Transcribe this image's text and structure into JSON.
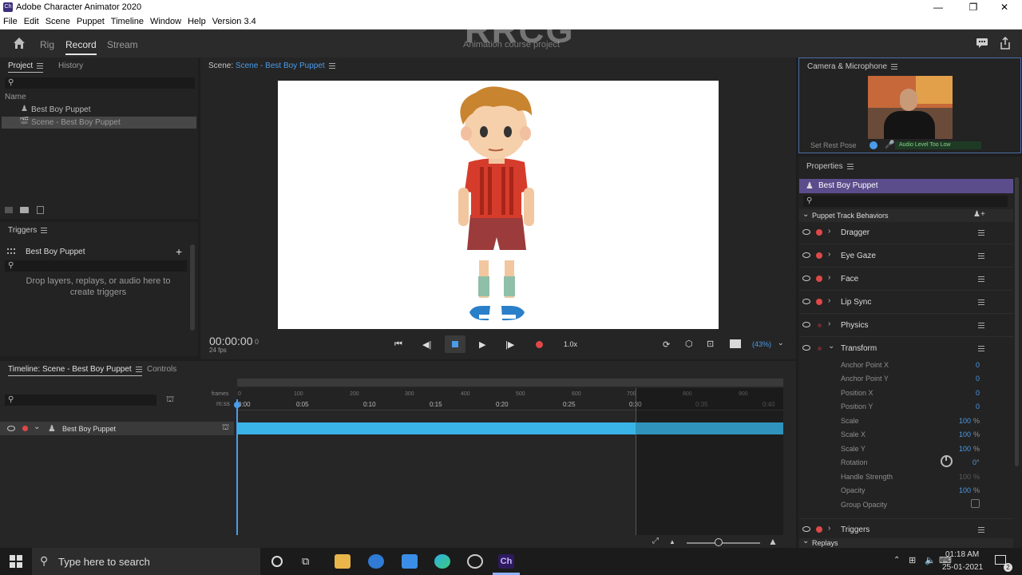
{
  "app": {
    "title": "Adobe Character Animator 2020",
    "icon_text": "Ch"
  },
  "menu": [
    "File",
    "Edit",
    "Scene",
    "Puppet",
    "Timeline",
    "Window",
    "Help",
    "Version 3.4"
  ],
  "modes": {
    "rig": "Rig",
    "record": "Record",
    "stream": "Stream"
  },
  "project_title": "Animation course project",
  "project_panel": {
    "tab_project": "Project",
    "tab_history": "History",
    "name_header": "Name",
    "items": [
      {
        "label": "Best Boy Puppet"
      },
      {
        "label": "Scene - Best Boy Puppet"
      }
    ]
  },
  "triggers_panel": {
    "title": "Triggers",
    "puppet": "Best Boy Puppet",
    "add": "+",
    "drop_hint": "Drop layers, replays, or audio here to create triggers"
  },
  "scene_panel": {
    "prefix": "Scene:",
    "name": "Scene - Best Boy Puppet",
    "timecode": "00:00:00",
    "frame": "0",
    "fps": "24 fps",
    "speed": "1.0x",
    "zoom": "(43%)"
  },
  "timeline": {
    "tab_timeline": "Timeline: Scene - Best Boy Puppet",
    "tab_controls": "Controls",
    "frames_label": "frames",
    "mss_label": "m:ss",
    "frame_ticks": [
      "0",
      "100",
      "200",
      "300",
      "400",
      "500",
      "600",
      "700",
      "800",
      "900"
    ],
    "time_ticks": [
      "0:00",
      "0:05",
      "0:10",
      "0:15",
      "0:20",
      "0:25",
      "0:30",
      "0:35",
      "0:40"
    ],
    "track_name": "Best Boy Puppet"
  },
  "camera_panel": {
    "title": "Camera & Microphone",
    "set_rest_pose": "Set Rest Pose",
    "audio_level": "Audio Level Too Low"
  },
  "properties": {
    "title": "Properties",
    "puppet": "Best Boy Puppet",
    "section": "Puppet Track Behaviors",
    "behaviors": [
      {
        "label": "Dragger"
      },
      {
        "label": "Eye Gaze"
      },
      {
        "label": "Face"
      },
      {
        "label": "Lip Sync"
      },
      {
        "label": "Physics"
      },
      {
        "label": "Transform"
      },
      {
        "label": "Triggers"
      }
    ],
    "transform_params": [
      {
        "label": "Anchor Point X",
        "value": "0",
        "unit": ""
      },
      {
        "label": "Anchor Point Y",
        "value": "0",
        "unit": ""
      },
      {
        "label": "Position X",
        "value": "0",
        "unit": ""
      },
      {
        "label": "Position Y",
        "value": "0",
        "unit": ""
      },
      {
        "label": "Scale",
        "value": "100",
        "unit": "%"
      },
      {
        "label": "Scale X",
        "value": "100",
        "unit": "%"
      },
      {
        "label": "Scale Y",
        "value": "100",
        "unit": "%"
      },
      {
        "label": "Rotation",
        "value": "0",
        "unit": "°"
      },
      {
        "label": "Handle Strength",
        "value": "100",
        "unit": "%"
      },
      {
        "label": "Opacity",
        "value": "100",
        "unit": "%"
      },
      {
        "label": "Group Opacity",
        "value": "",
        "unit": ""
      }
    ],
    "replays": "Replays"
  },
  "taskbar": {
    "search_placeholder": "Type here to search",
    "time": "01:18 AM",
    "date": "25-01-2021",
    "notif_count": "2"
  },
  "watermark": "RRCG",
  "colors": {
    "accent_blue": "#4a9bea",
    "record_red": "#e04848",
    "puppet_header": "#5b4d8c",
    "track_bar": "#3ab4e6"
  }
}
